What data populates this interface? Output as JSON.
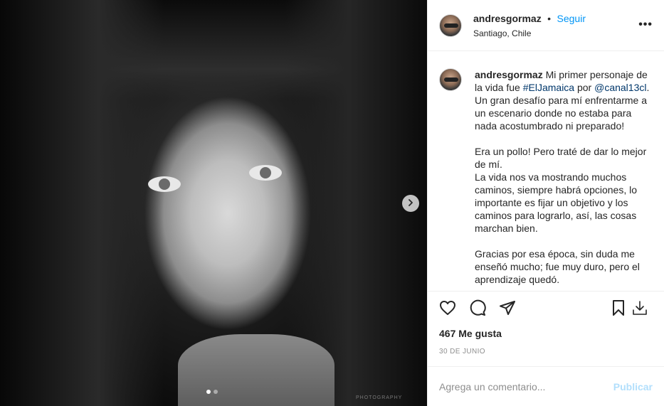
{
  "post": {
    "photo_alt": "Retrato en blanco y negro",
    "watermark": "PHOTOGRAPHY",
    "carousel_total": 2,
    "carousel_active": 1
  },
  "header": {
    "username": "andresgormaz",
    "separator": "•",
    "follow_label": "Seguir",
    "location": "Santiago, Chile",
    "more_label": "•••"
  },
  "caption": {
    "username": "andresgormaz",
    "text_1": "Mi primer personaje de la vida fue ",
    "hashtag": "#ElJamaica",
    "text_2": " por ",
    "mention": "@canal13cl",
    "text_3": ".\nUn gran desafío para mí enfrentarme a un escenario donde no estaba para nada acostumbrado ni preparado!",
    "paragraph_2": "Era un pollo! Pero traté de dar lo mejor de mí.\nLa vida nos va mostrando muchos caminos, siempre habrá opciones, lo importante es fijar un objetivo y los caminos para lograrlo, así, las cosas marchan bien.",
    "paragraph_3": "Gracias por esa época, sin duda me enseñó mucho; fue muy duro, pero el aprendizaje quedó."
  },
  "stats": {
    "likes": "467 Me gusta",
    "date": "30 DE JUNIO"
  },
  "comment": {
    "placeholder": "Agrega un comentario...",
    "publish_label": "Publicar"
  },
  "colors": {
    "accent": "#0095f6",
    "publish_disabled": "#b2dffc",
    "link": "#00376b",
    "muted": "#8e8e8e"
  },
  "icons": [
    "heart-icon",
    "comment-icon",
    "share-icon",
    "bookmark-icon",
    "download-icon",
    "chevron-right-icon",
    "more-icon"
  ]
}
